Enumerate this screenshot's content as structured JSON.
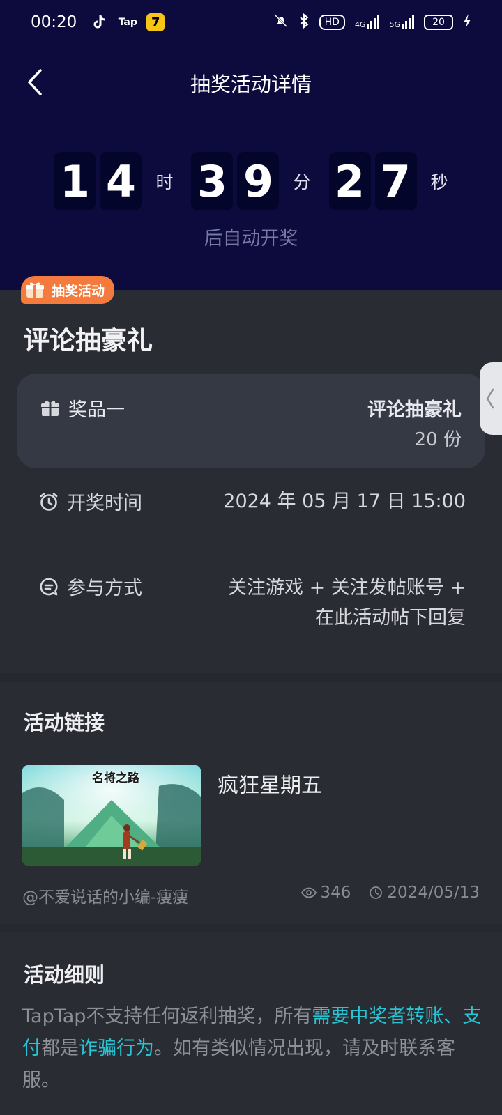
{
  "status": {
    "time": "00:20",
    "apps": [
      "TikTok",
      "Tap",
      "7"
    ],
    "hd": "HD",
    "net1": "4G",
    "net2": "5G",
    "battery": "20"
  },
  "nav": {
    "title": "抽奖活动详情"
  },
  "countdown": {
    "hours": [
      "1",
      "4"
    ],
    "minutes": [
      "3",
      "9"
    ],
    "seconds": [
      "2",
      "7"
    ],
    "hour_unit": "时",
    "minute_unit": "分",
    "second_unit": "秒",
    "subtitle": "后自动开奖"
  },
  "activity": {
    "tag": "抽奖活动",
    "title": "评论抽豪礼",
    "prize": {
      "label": "奖品一",
      "name": "评论抽豪礼",
      "count": "20 份"
    },
    "draw_time": {
      "label": "开奖时间",
      "value": "2024 年 05 月 17 日 15:00"
    },
    "join": {
      "label": "参与方式",
      "value_line1": "关注游戏 + 关注发帖账号 +",
      "value_line2": "在此活动帖下回复"
    }
  },
  "link": {
    "section_title": "活动链接",
    "thumb_text": "名将之路",
    "title": "疯狂星期五",
    "author": "@不爱说话的小编-瘦瘦",
    "views": "346",
    "date": "2024/05/13"
  },
  "rules": {
    "title": "活动细则",
    "p1": "TapTap不支持任何返利抽奖，所有",
    "h1": "需要中奖者转账、支付",
    "p2": "都是",
    "h2": "诈骗行为",
    "p3": "。如有类似情况出现，请及时联系客服。"
  },
  "colors": {
    "header_bg": "#0d0b3d",
    "accent_orange": "#f47b3d",
    "link_cyan": "#28c4d3"
  },
  "icons": [
    "back-icon",
    "gift-icon",
    "alarm-clock-icon",
    "chat-icon",
    "eye-icon",
    "clock-icon",
    "chevron-left-icon"
  ]
}
